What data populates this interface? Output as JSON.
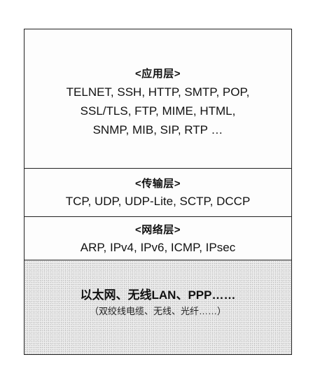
{
  "layers": {
    "application": {
      "title": "<应用层>",
      "protocols": [
        "TELNET, SSH, HTTP, SMTP, POP,",
        "SSL/TLS, FTP, MIME, HTML,",
        "SNMP, MIB, SIP, RTP …"
      ]
    },
    "transport": {
      "title": "<传输层>",
      "protocols": [
        "TCP, UDP, UDP-Lite, SCTP, DCCP"
      ]
    },
    "network": {
      "title": "<网络层>",
      "protocols": [
        "ARP, IPv4, IPv6, ICMP, IPsec"
      ]
    },
    "link": {
      "main": "以太网、无线LAN、PPP……",
      "sub": "（双绞线电缆、无线、光纤……）"
    }
  },
  "colors": {
    "border": "#222222",
    "link_layer_fill": "#ececec",
    "text": "#111111"
  }
}
